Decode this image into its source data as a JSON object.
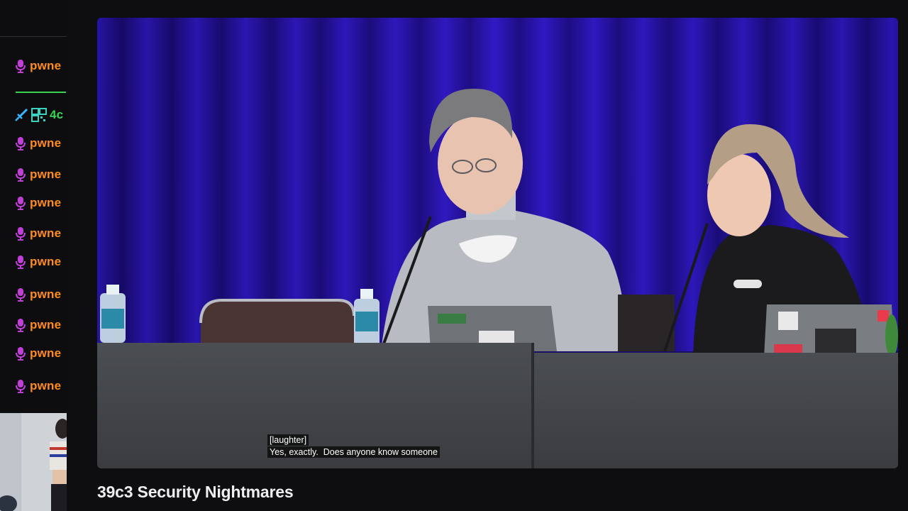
{
  "chat": {
    "messages": [
      {
        "name": "pwne",
        "badge": "mic-icon"
      },
      {
        "name": "4c",
        "badge": "sword-icon"
      },
      {
        "name": "pwne",
        "badge": "mic-icon"
      },
      {
        "name": "pwne",
        "badge": "mic-icon"
      },
      {
        "name": "pwne",
        "badge": "mic-icon"
      },
      {
        "name": "pwne",
        "badge": "mic-icon"
      },
      {
        "name": "pwne",
        "badge": "mic-icon"
      },
      {
        "name": "pwne",
        "badge": "mic-icon"
      },
      {
        "name": "pwne",
        "badge": "mic-icon"
      },
      {
        "name": "pwne",
        "badge": "mic-icon"
      },
      {
        "name": "pwne",
        "badge": "mic-icon"
      }
    ]
  },
  "player": {
    "captions": [
      "[laughter]",
      "Yes, exactly.  Does anyone know someone"
    ]
  },
  "video": {
    "title": "39c3 Security Nightmares"
  },
  "colors": {
    "username": "#ff8c1a",
    "username_alt": "#39d353",
    "mic_badge": "#c13fd8",
    "curtain": "#2a14b0"
  }
}
